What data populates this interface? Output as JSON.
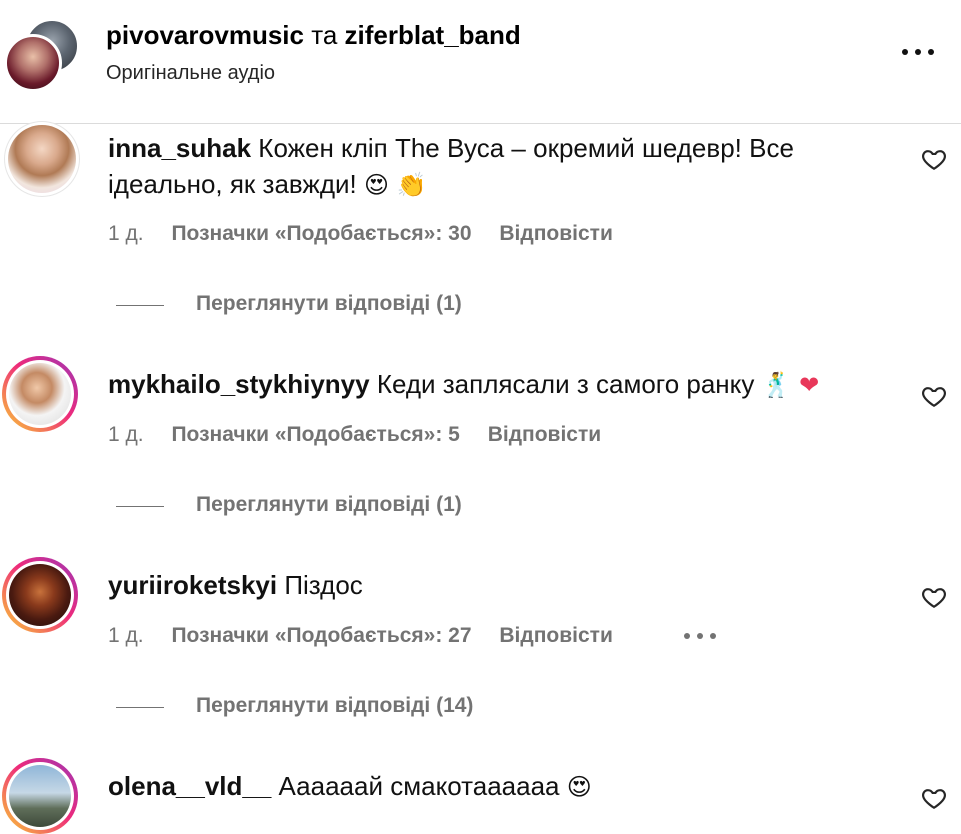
{
  "header": {
    "user1": "pivovarovmusic",
    "connector": "та",
    "user2": "ziferblat_band",
    "subtitle": "Оригінальне аудіо"
  },
  "comments": [
    {
      "username": "inna_suhak",
      "text": "Кожен кліп The Вуса – окремий шедевр! Все ідеально, як завжди!",
      "emoji": "😍 👏",
      "time": "1 д.",
      "likes": "Позначки «Подобається»: 30",
      "reply": "Відповісти",
      "view_replies": "Переглянути відповіді (1)",
      "avatar_ring": "none"
    },
    {
      "username": "mykhailo_stykhiynyy",
      "text": "Кеди заплясали з самого ранку",
      "emoji": "🕺 ❤",
      "time": "1 д.",
      "likes": "Позначки «Подобається»: 5",
      "reply": "Відповісти",
      "view_replies": "Переглянути відповіді (1)",
      "avatar_ring": "story"
    },
    {
      "username": "yuriiroketskyi",
      "text": "Піздос",
      "emoji": "",
      "time": "1 д.",
      "likes": "Позначки «Подобається»: 27",
      "reply": "Відповісти",
      "view_replies": "Переглянути відповіді (14)",
      "avatar_ring": "story"
    },
    {
      "username": "olena__vld__",
      "text": "Аааааай смакотаааааа",
      "emoji": "😍",
      "avatar_ring": "story"
    }
  ],
  "icons": {
    "more": "more-horizontal-icon",
    "like": "heart-outline-icon"
  },
  "colors": {
    "text": "#000000",
    "secondary": "#737373",
    "divider": "#dbdbdb",
    "story_ring_start": "#f9ce34",
    "story_ring_mid": "#ee2a7b",
    "story_ring_end": "#9b36b7",
    "heart_emoji": "#e8385a"
  }
}
